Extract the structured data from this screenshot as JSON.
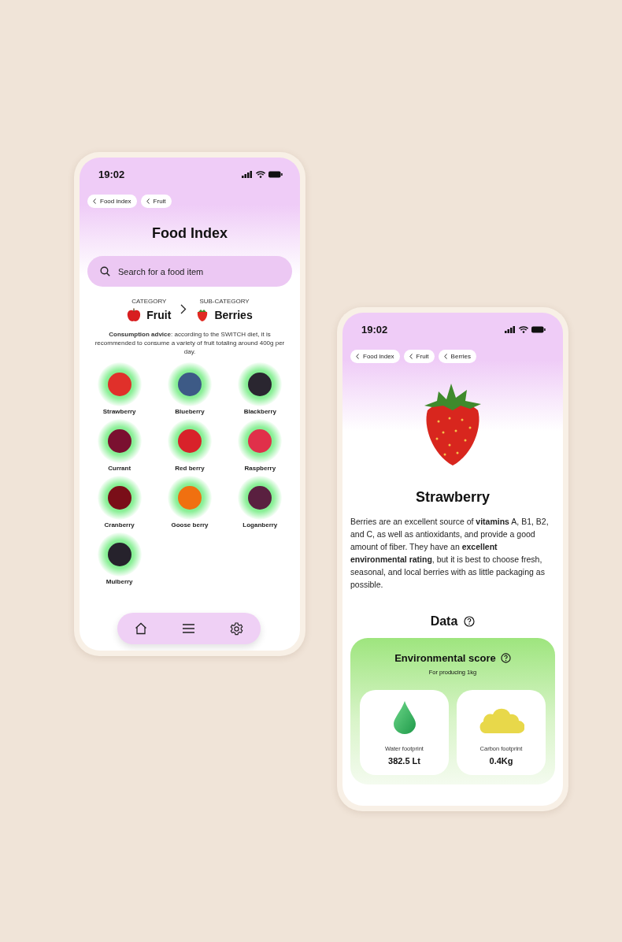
{
  "index_screen": {
    "status_bar": {
      "time": "19:02"
    },
    "breadcrumbs": [
      "Food index",
      "Fruit"
    ],
    "title": "Food Index",
    "search": {
      "placeholder": "Search for a food item"
    },
    "category": {
      "label": "CATEGORY",
      "value": "Fruit"
    },
    "sub_category": {
      "label": "SUB-CATEGORY",
      "value": "Berries"
    },
    "advice": "**Consumption advice**: according to the SWITCH diet, it is recommended to consume a variety of fruit totaling around 400g per day.",
    "items": [
      {
        "name": "Strawberry",
        "color": "#e0302a"
      },
      {
        "name": "Blueberry",
        "color": "#3d5a86"
      },
      {
        "name": "Blackberry",
        "color": "#2a2630"
      },
      {
        "name": "Currant",
        "color": "#7a1030"
      },
      {
        "name": "Red berry",
        "color": "#d8222a"
      },
      {
        "name": "Raspberry",
        "color": "#e0304a"
      },
      {
        "name": "Cranberry",
        "color": "#7a0e18"
      },
      {
        "name": "Goose berry",
        "color": "#f07010"
      },
      {
        "name": "Loganberry",
        "color": "#5a2040"
      },
      {
        "name": "Mulberry",
        "color": "#26222c"
      }
    ],
    "nav_bar": [
      {
        "kind": "home"
      },
      {
        "kind": "menu"
      },
      {
        "kind": "settings"
      }
    ]
  },
  "detail_screen": {
    "status_bar": {
      "time": "19:02"
    },
    "breadcrumbs": [
      "Food index",
      "Fruit",
      "Berries"
    ],
    "title": "Strawberry",
    "description": "Berries are an excellent source of **vitamins** A, B1, B2, and C, as well as antioxidants, and provide a good amount of fiber. They have an **excellent environmental rating**, but it is best to choose fresh, seasonal, and local berries with as little packaging as possible.",
    "data_heading": "Data",
    "environmental_score": {
      "title": "Environmental score",
      "subtitle": "For producing 1kg",
      "metrics": [
        {
          "kind": "water",
          "label": "Water footprint",
          "value": "382.5 Lt"
        },
        {
          "kind": "carbon",
          "label": "Carbon footprint",
          "value": "0.4Kg"
        }
      ]
    }
  }
}
